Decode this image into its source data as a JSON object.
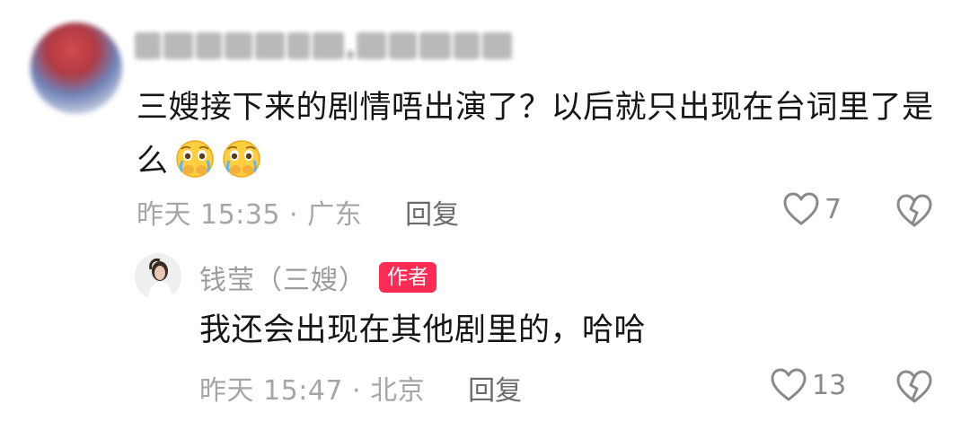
{
  "comment": {
    "text": "三嫂接下来的剧情唔出演了？以后就只出现在台词里了是么",
    "emoji": "cry-face-emoji",
    "time_location": "昨天 15:35 · 广东",
    "reply_label": "回复",
    "like_count": "7"
  },
  "reply": {
    "username": "钱莹（三嫂）",
    "badge": "作者",
    "text": "我还会出现在其他剧里的，哈哈",
    "time_location": "昨天 15:47 · 北京",
    "reply_label": "回复",
    "like_count": "13"
  },
  "colors": {
    "badge": "#fe2c55",
    "text_primary": "#161616",
    "text_secondary": "#a6a6a6",
    "icon": "#8a8a8a"
  },
  "icons": [
    "heart-outline-icon",
    "broken-heart-icon",
    "cry-face-emoji"
  ]
}
